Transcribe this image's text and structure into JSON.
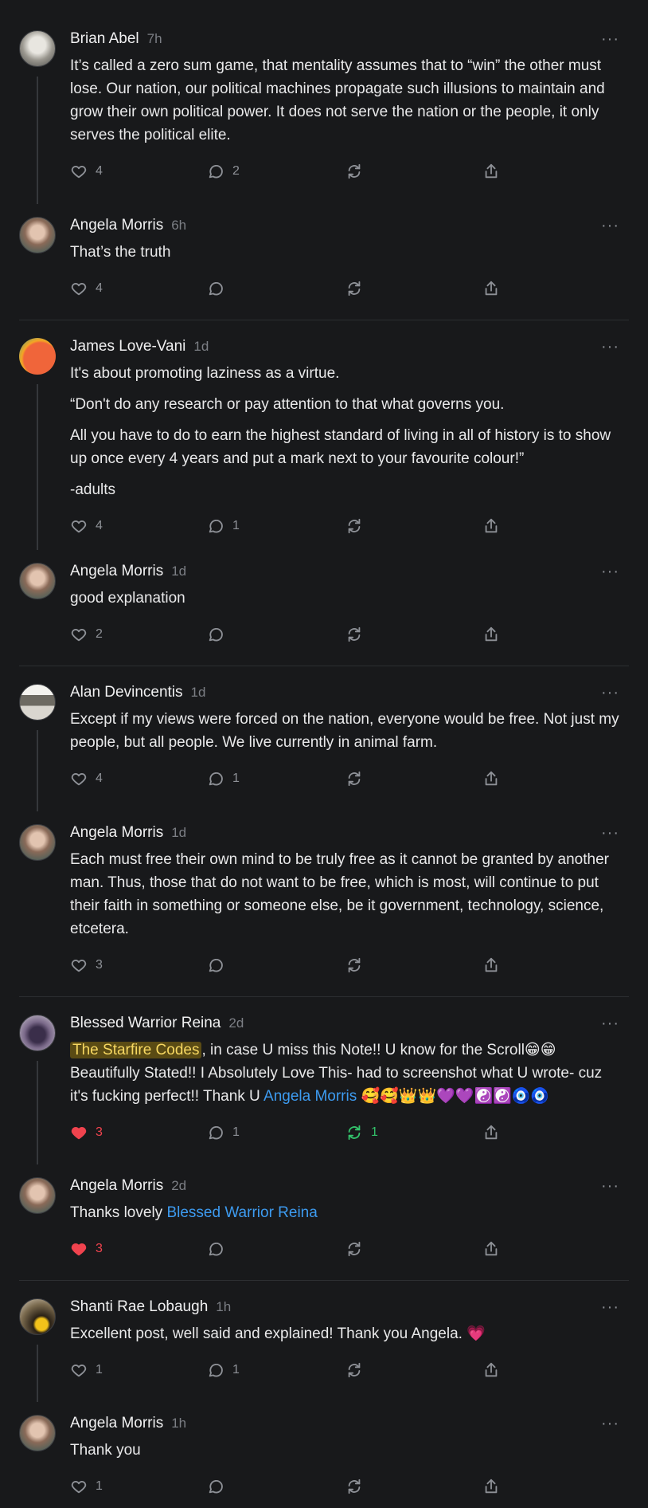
{
  "threads": [
    {
      "comments": [
        {
          "name": "Brian Abel",
          "time": "7h",
          "paragraphs": [
            "It’s called a zero sum game, that mentality assumes that to “win” the other must lose. Our nation, our political machines propagate such illusions to maintain and grow their own political power. It does not serve the nation or the people, it only serves the political elite."
          ],
          "likes": "4",
          "replies": "2",
          "restacks": ""
        },
        {
          "name": "Angela Morris",
          "time": "6h",
          "paragraphs": [
            "That’s the truth"
          ],
          "likes": "4",
          "replies": "",
          "restacks": ""
        }
      ]
    },
    {
      "comments": [
        {
          "name": "James Love-Vani",
          "time": "1d",
          "paragraphs": [
            "It's about promoting laziness as a virtue.",
            "“Don't do any research or pay attention to that what governs you.",
            "All you have to do to earn the highest standard of living in all of history is to show up once every 4 years and put a mark next to your favourite colour!”",
            "-adults"
          ],
          "likes": "4",
          "replies": "1",
          "restacks": ""
        },
        {
          "name": "Angela Morris",
          "time": "1d",
          "paragraphs": [
            "good explanation"
          ],
          "likes": "2",
          "replies": "",
          "restacks": ""
        }
      ]
    },
    {
      "comments": [
        {
          "name": "Alan Devincentis",
          "time": "1d",
          "paragraphs": [
            "Except if my views were forced on the nation, everyone would be free. Not just my people, but all people. We live currently in animal farm."
          ],
          "likes": "4",
          "replies": "1",
          "restacks": ""
        },
        {
          "name": "Angela Morris",
          "time": "1d",
          "paragraphs": [
            "Each must free their own mind to be truly free as it cannot be granted by another man. Thus, those that do not want to be free, which is most, will continue to put their faith in something or someone else, be it government, technology, science, etcetera."
          ],
          "likes": "3",
          "replies": "",
          "restacks": ""
        }
      ]
    },
    {
      "comments": [
        {
          "name": "Blessed Warrior Reina",
          "time": "2d",
          "highlight": "The Starfire Codes",
          "text_after_highlight": ", in case U miss this Note!! U know for the Scroll😁😁 Beautifully Stated!! I Absolutely Love This- had to screenshot what U wrote- cuz it's fucking perfect!! Thank U ",
          "mention": "Angela Morris",
          "text_after_mention": " 🥰🥰👑👑💜💜☯️☯️🧿🧿",
          "likes": "3",
          "replies": "1",
          "restacks": "1"
        },
        {
          "name": "Angela Morris",
          "time": "2d",
          "text_before_mention": "Thanks lovely ",
          "mention": "Blessed Warrior Reina",
          "likes": "3",
          "replies": "",
          "restacks": ""
        }
      ]
    },
    {
      "comments": [
        {
          "name": "Shanti Rae Lobaugh",
          "time": "1h",
          "paragraphs": [
            "Excellent post, well said and explained! Thank you Angela. 💗"
          ],
          "likes": "1",
          "replies": "1",
          "restacks": ""
        },
        {
          "name": "Angela Morris",
          "time": "1h",
          "paragraphs": [
            "Thank you"
          ],
          "likes": "1",
          "replies": "",
          "restacks": ""
        }
      ]
    }
  ],
  "more_label": "···",
  "icons": {
    "like": "heart-icon",
    "reply": "comment-bubble-icon",
    "restack": "restack-icon",
    "share": "share-icon"
  },
  "colors": {
    "liked": "#f0434e",
    "restacked": "#33c26b",
    "mention": "#3d9bf0",
    "highlight_bg": "#5a4b14",
    "highlight_text": "#f6d761"
  }
}
